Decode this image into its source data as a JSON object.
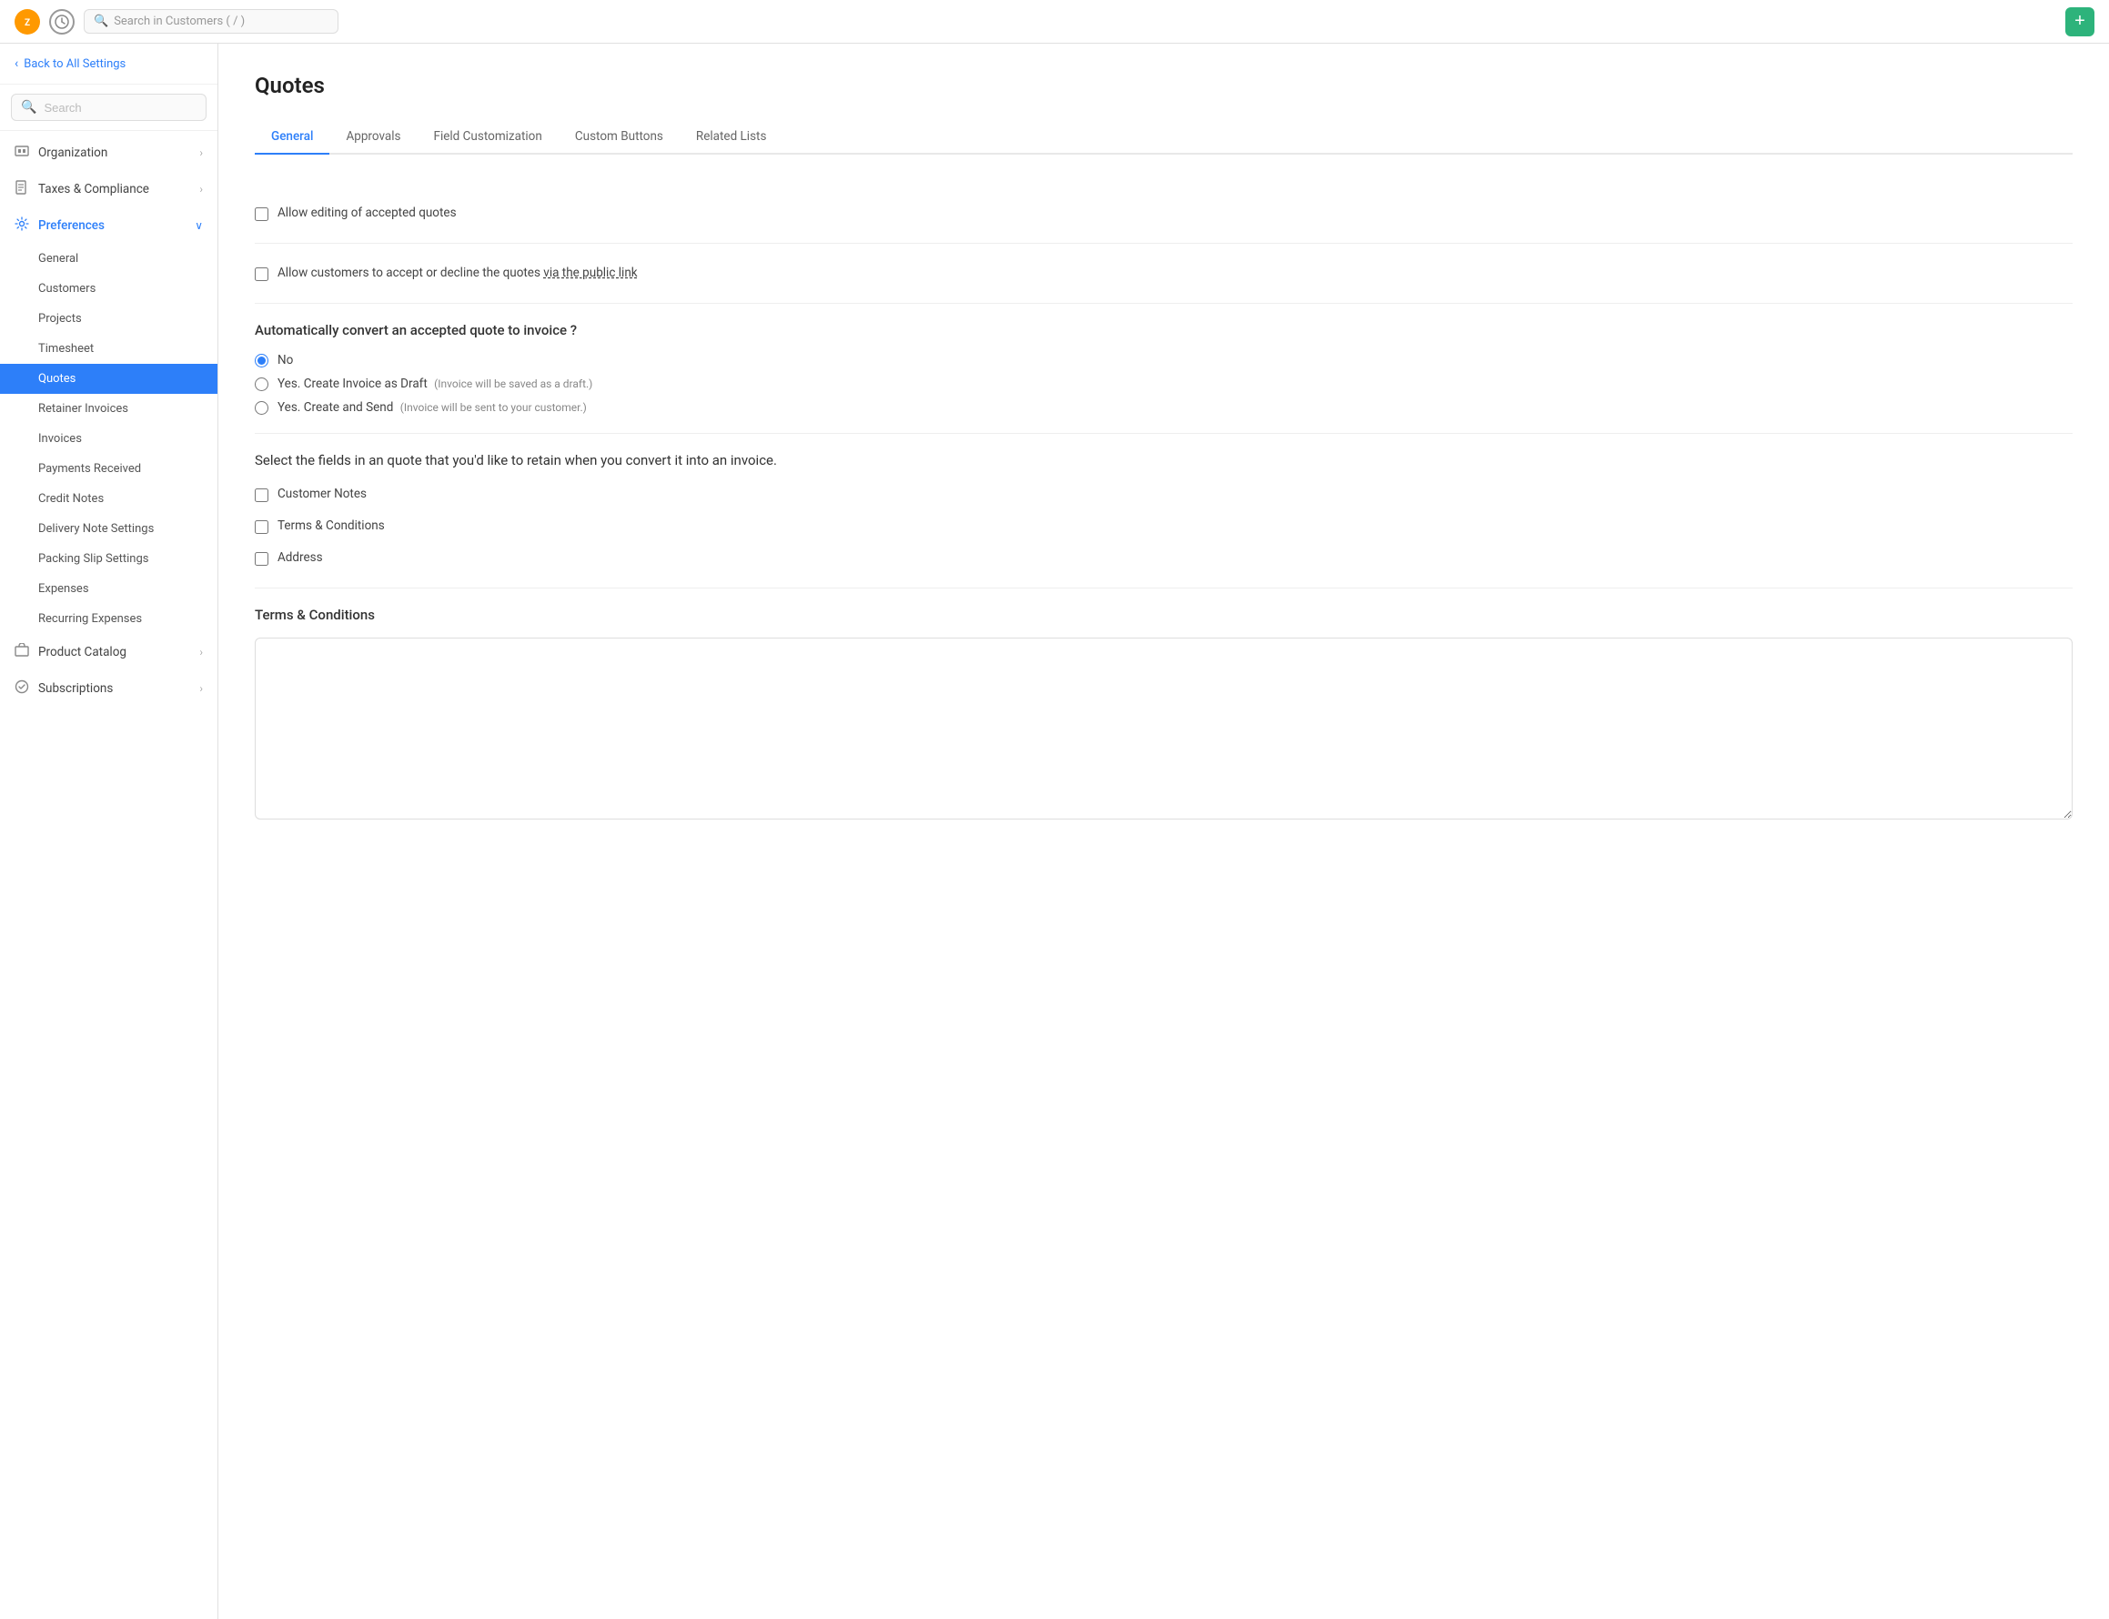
{
  "topbar": {
    "logo_text": "Z",
    "search_placeholder": "Search in Customers ( / )",
    "add_button_label": "+"
  },
  "sidebar": {
    "back_label": "Back to All Settings",
    "search_placeholder": "Search",
    "nav_items": [
      {
        "id": "organization",
        "label": "Organization",
        "icon": "🏢",
        "has_arrow": true,
        "active": false
      },
      {
        "id": "taxes",
        "label": "Taxes & Compliance",
        "icon": "📄",
        "has_arrow": true,
        "active": false
      },
      {
        "id": "preferences",
        "label": "Preferences",
        "icon": "⚙",
        "has_arrow": true,
        "active": true,
        "expanded": true
      }
    ],
    "pref_sub_items": [
      {
        "id": "general",
        "label": "General",
        "active": false
      },
      {
        "id": "customers",
        "label": "Customers",
        "active": false
      },
      {
        "id": "projects",
        "label": "Projects",
        "active": false
      },
      {
        "id": "timesheet",
        "label": "Timesheet",
        "active": false
      },
      {
        "id": "quotes",
        "label": "Quotes",
        "active": true
      },
      {
        "id": "retainer-invoices",
        "label": "Retainer Invoices",
        "active": false
      },
      {
        "id": "invoices",
        "label": "Invoices",
        "active": false
      },
      {
        "id": "payments-received",
        "label": "Payments Received",
        "active": false
      },
      {
        "id": "credit-notes",
        "label": "Credit Notes",
        "active": false
      },
      {
        "id": "delivery-note-settings",
        "label": "Delivery Note Settings",
        "active": false
      },
      {
        "id": "packing-slip-settings",
        "label": "Packing Slip Settings",
        "active": false
      },
      {
        "id": "expenses",
        "label": "Expenses",
        "active": false
      },
      {
        "id": "recurring-expenses",
        "label": "Recurring Expenses",
        "active": false
      }
    ],
    "bottom_items": [
      {
        "id": "product-catalog",
        "label": "Product Catalog",
        "icon": "🛍",
        "has_arrow": true
      },
      {
        "id": "subscriptions",
        "label": "Subscriptions",
        "icon": "🔄",
        "has_arrow": true
      }
    ]
  },
  "main": {
    "page_title": "Quotes",
    "tabs": [
      {
        "id": "general",
        "label": "General",
        "active": true
      },
      {
        "id": "approvals",
        "label": "Approvals",
        "active": false
      },
      {
        "id": "field-customization",
        "label": "Field Customization",
        "active": false
      },
      {
        "id": "custom-buttons",
        "label": "Custom Buttons",
        "active": false
      },
      {
        "id": "related-lists",
        "label": "Related Lists",
        "active": false
      }
    ],
    "allow_editing_label": "Allow editing of accepted quotes",
    "allow_customers_label": "Allow customers to accept or decline the quotes",
    "via_public_link": "via the public link",
    "auto_convert_title": "Automatically convert an accepted quote to invoice ?",
    "radio_options": [
      {
        "id": "no",
        "label": "No",
        "note": "",
        "checked": true
      },
      {
        "id": "yes-draft",
        "label": "Yes. Create Invoice as Draft",
        "note": "(Invoice will be saved as a draft.)",
        "checked": false
      },
      {
        "id": "yes-send",
        "label": "Yes. Create and Send",
        "note": "(Invoice will be sent to your customer.)",
        "checked": false
      }
    ],
    "retain_title": "Select the fields in an quote that you'd like to retain when you convert it into an invoice.",
    "retain_fields": [
      {
        "id": "customer-notes",
        "label": "Customer Notes",
        "checked": false
      },
      {
        "id": "terms-conditions",
        "label": "Terms & Conditions",
        "checked": false
      },
      {
        "id": "address",
        "label": "Address",
        "checked": false
      }
    ],
    "terms_title": "Terms & Conditions",
    "terms_value": ""
  }
}
